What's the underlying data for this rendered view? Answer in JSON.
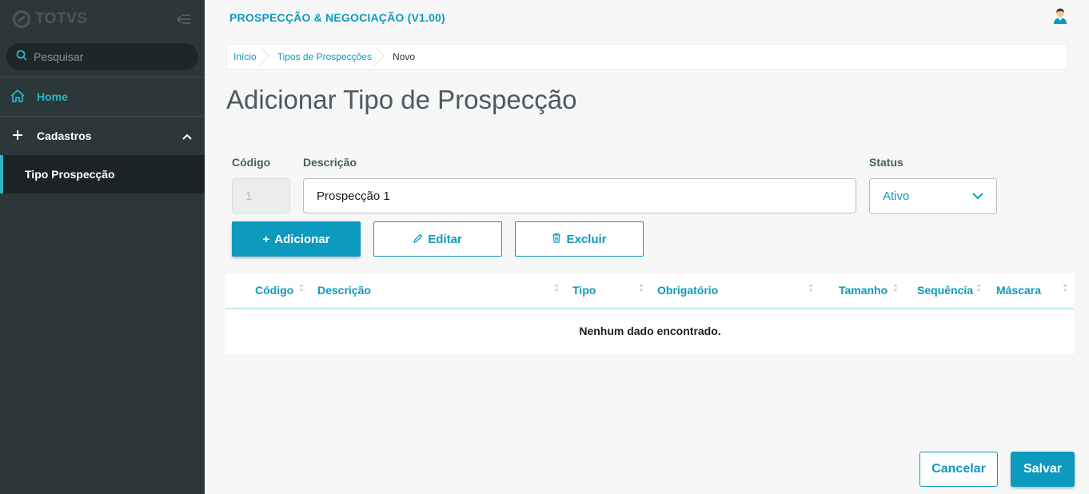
{
  "sidebar": {
    "logo_text": "TOTVS",
    "search_placeholder": "Pesquisar",
    "home_label": "Home",
    "cadastros_label": "Cadastros",
    "submenu_label": "Tipo Prospecção"
  },
  "header": {
    "app_title": "PROSPECÇÃO & NEGOCIAÇÃO (V1.00)"
  },
  "breadcrumb": [
    "Início",
    "Tipos de Prospecções",
    "Novo"
  ],
  "page_title": "Adicionar Tipo de Prospecção",
  "form": {
    "codigo_label": "Código",
    "codigo_value": "1",
    "descricao_label": "Descrição",
    "descricao_value": "Prospecção 1",
    "status_label": "Status",
    "status_value": "Ativo"
  },
  "actions": {
    "add": "Adicionar",
    "add_prefix": "+",
    "edit": "Editar",
    "delete": "Excluir"
  },
  "table": {
    "columns": [
      "Código",
      "Descrição",
      "Tipo",
      "Obrigatório",
      "Tamanho",
      "Sequência",
      "Máscara"
    ],
    "empty_message": "Nenhum dado encontrado."
  },
  "footer": {
    "cancel": "Cancelar",
    "save": "Salvar"
  },
  "colors": {
    "accent": "#0c9abe",
    "sidebar_bg": "#2c3739",
    "home_accent": "#29b6c5"
  }
}
